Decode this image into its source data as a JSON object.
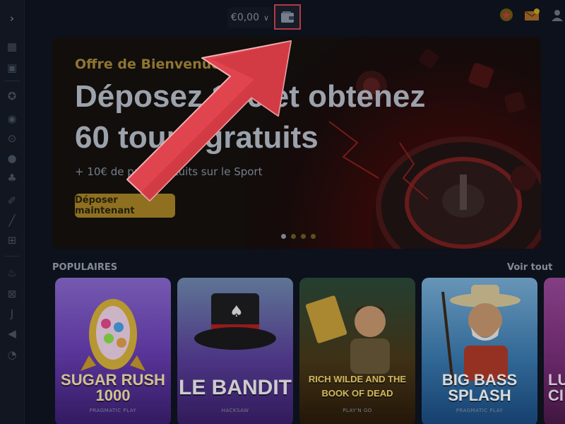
{
  "topbar": {
    "balance": "€0,00",
    "balance_chevron_icon": "chevron-down-icon",
    "wallet_icon": "wallet-icon",
    "right_icons": [
      "star-badge-icon",
      "mail-icon",
      "user-icon"
    ]
  },
  "sidebar": {
    "icons": [
      "chevron-right-icon",
      "casino-icon",
      "cards-icon",
      "football-icon",
      "live-icon",
      "soccer-icon",
      "basketball-icon",
      "tennis-icon",
      "baseball-icon",
      "hockey-icon",
      "esports-icon",
      "fire-icon",
      "gift-icon",
      "juventus-icon",
      "megaphone-icon",
      "whistle-icon"
    ]
  },
  "banner": {
    "subtitle": "Offre de Bienvenue",
    "title": "Déposez 10€ et obtenez\n60 tours gratuits",
    "note": "+ 10€ de paris gratuits sur le Sport",
    "cta": "Déposer maintenant",
    "slides": 4,
    "active_slide": 1
  },
  "popular": {
    "title": "POPULAIRES",
    "see_all": "Voir tout",
    "games": [
      {
        "name": "SUGAR RUSH\n1000",
        "provider": "PRAGMATIC PLAY",
        "color": "#6a3fb5"
      },
      {
        "name": "LE BANDIT",
        "provider": "HACKSAW",
        "color": "#5a2f8a"
      },
      {
        "name": "RICH WILDE AND THE\nBOOK OF DEAD",
        "provider": "PLAY'N GO",
        "color": "#7a5a1a"
      },
      {
        "name": "BIG BASS\nSPLASH",
        "provider": "PRAGMATIC PLAY",
        "color": "#2a6aa0"
      },
      {
        "name": "LU\nCI",
        "provider": "",
        "color": "#7a2f7a"
      }
    ]
  },
  "annotation": {
    "arrow_color": "#e0454f"
  }
}
